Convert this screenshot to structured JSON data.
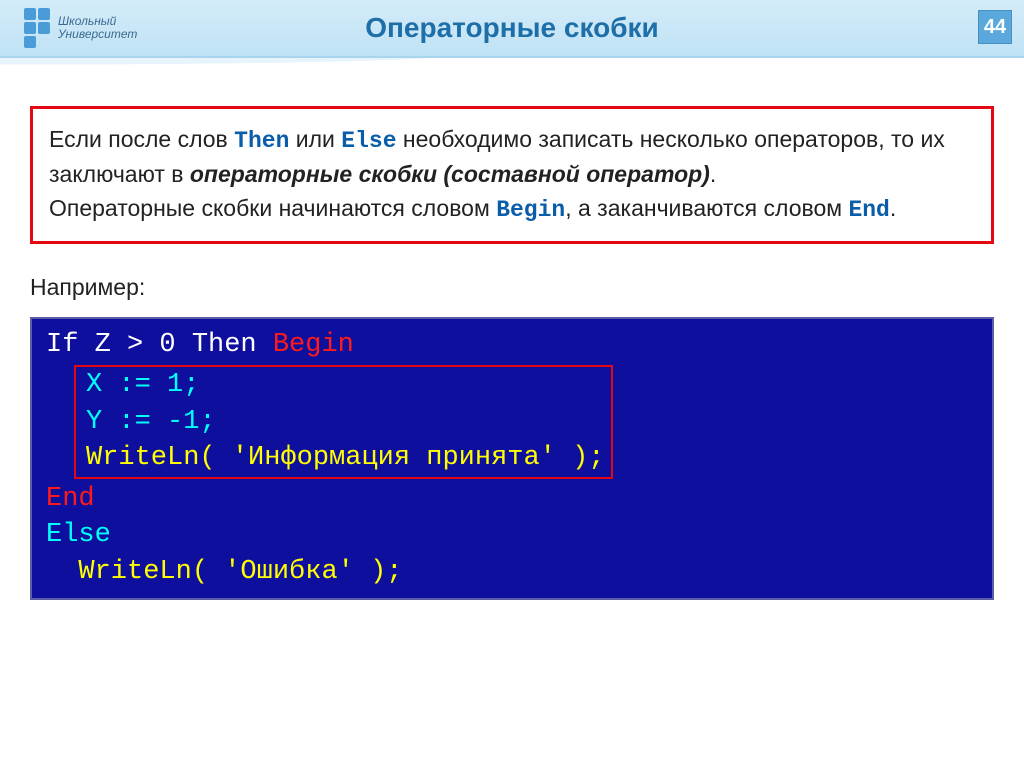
{
  "header": {
    "logo_line1": "Школьный",
    "logo_line2": "Университет",
    "title": "Операторные скобки",
    "page_number": "44"
  },
  "info": {
    "part1a": "Если после слов ",
    "kw_then": "Then",
    "part1b": "  или ",
    "kw_else": "Else",
    "part1c": " необходимо записать  несколько операторов, то их заключают в ",
    "bold_phrase": "операторные скобки (составной оператор)",
    "part1d": ".",
    "part2a": "Операторные скобки начинаются словом ",
    "kw_begin": "Begin",
    "part2b": ", а заканчиваются словом ",
    "kw_end": "End",
    "part2c": "."
  },
  "example_label": "Например:",
  "code": {
    "l1_if": "If ",
    "l1_cond": "Z > 0 ",
    "l1_then": "Then ",
    "l1_begin": "Begin",
    "l2": "X := 1;",
    "l3": "Y := -1;",
    "l4_proc": "WriteLn( ",
    "l4_arg": "'Информация принята' ",
    "l4_close": ");",
    "l5_end": "End",
    "l6_else": "Else",
    "l7_indent": "  ",
    "l7_proc": "WriteLn( ",
    "l7_arg": "'Ошибка' ",
    "l7_close": ");"
  }
}
